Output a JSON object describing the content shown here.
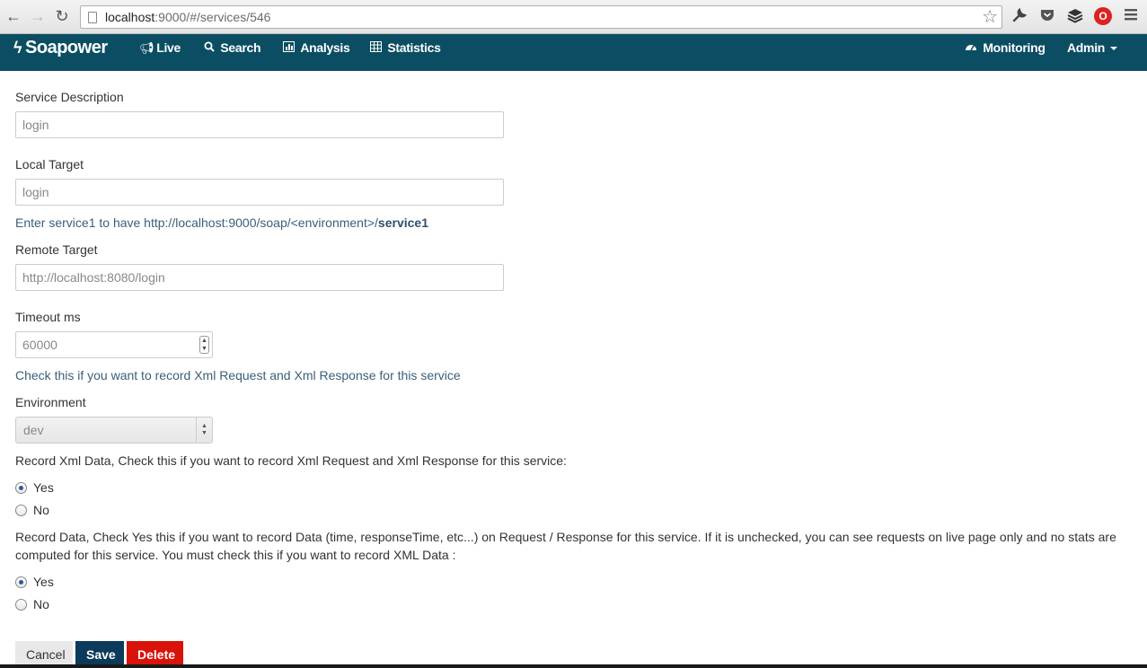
{
  "browser": {
    "back_icon": "←",
    "forward_icon": "→",
    "reload_icon": "↻",
    "url_host": "localhost",
    "url_path": ":9000/#/services/546",
    "star_icon": "☆"
  },
  "navbar": {
    "brand": "Soapower",
    "items": {
      "live": "Live",
      "search": "Search",
      "analysis": "Analysis",
      "statistics": "Statistics",
      "monitoring": "Monitoring",
      "admin": "Admin"
    }
  },
  "form": {
    "description_label": "Service Description",
    "description_value": "login",
    "local_target_label": "Local Target",
    "local_target_value": "login",
    "local_target_help_prefix": "Enter service1 to have http://localhost:9000/soap/<environment>/",
    "local_target_help_bold": "service1",
    "remote_target_label": "Remote Target",
    "remote_target_value": "http://localhost:8080/login",
    "timeout_label": "Timeout ms",
    "timeout_value": "60000",
    "timeout_help": "Check this if you want to record Xml Request and Xml Response for this service",
    "environment_label": "Environment",
    "environment_value": "dev",
    "record_xml_label": "Record Xml Data, Check this if you want to record Xml Request and Xml Response for this service:",
    "record_xml_yes": "Yes",
    "record_xml_no": "No",
    "record_data_label": "Record Data, Check Yes this if you want to record Data (time, responseTime, etc...) on Request / Response for this service. If it is unchecked, you can see requests on live page only and no stats are computed for this service. You must check this if you want to record XML Data :",
    "record_data_yes": "Yes",
    "record_data_no": "No"
  },
  "buttons": {
    "cancel": "Cancel",
    "save": "Save",
    "delete": "Delete"
  },
  "state": {
    "record_xml": "yes",
    "record_data": "yes"
  },
  "colors": {
    "navbar": "#0b4e63",
    "save": "#0b3a5a",
    "delete": "#d9120a"
  }
}
